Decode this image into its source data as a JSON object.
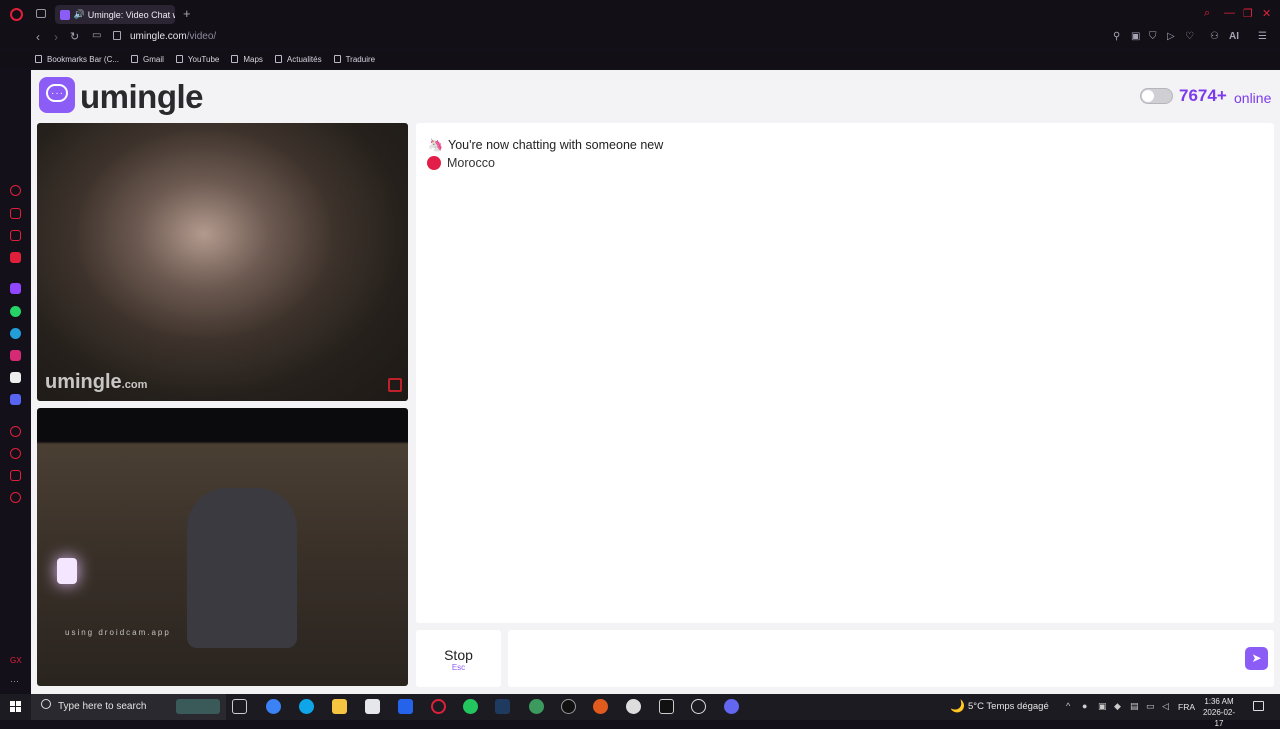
{
  "browser": {
    "tab_title": "Umingle: Video Chat w",
    "new_tab": "+",
    "url_host": "umingle.com",
    "url_path": "/video/",
    "ai_label": "AI",
    "bookmarks": [
      "Bookmarks Bar (C...",
      "Gmail",
      "YouTube",
      "Maps",
      "Actualités",
      "Traduire"
    ]
  },
  "site": {
    "logo": "umingle",
    "online_count": "7674+",
    "online_label": "online",
    "dark_mode_on": false,
    "video_watermark": "umingle",
    "video_watermark_suffix": ".com",
    "local_overlay_text": "using droidcam.app",
    "system_message": "You're now chatting with someone new",
    "system_icon": "🦄",
    "country": "Morocco",
    "stop_label": "Stop",
    "stop_hint": "Esc",
    "message_placeholder": "",
    "send_icon": "send-icon"
  },
  "taskbar": {
    "search_placeholder": "Type here to search",
    "weather": "5°C  Temps dégagé",
    "language": "FRA",
    "time": "1:36 AM",
    "date": "2026-02-17"
  },
  "colors": {
    "accent": "#8b5cf6",
    "online": "#7c3aed",
    "country_dot": "#e11d48",
    "browser_red": "#e0203a"
  }
}
